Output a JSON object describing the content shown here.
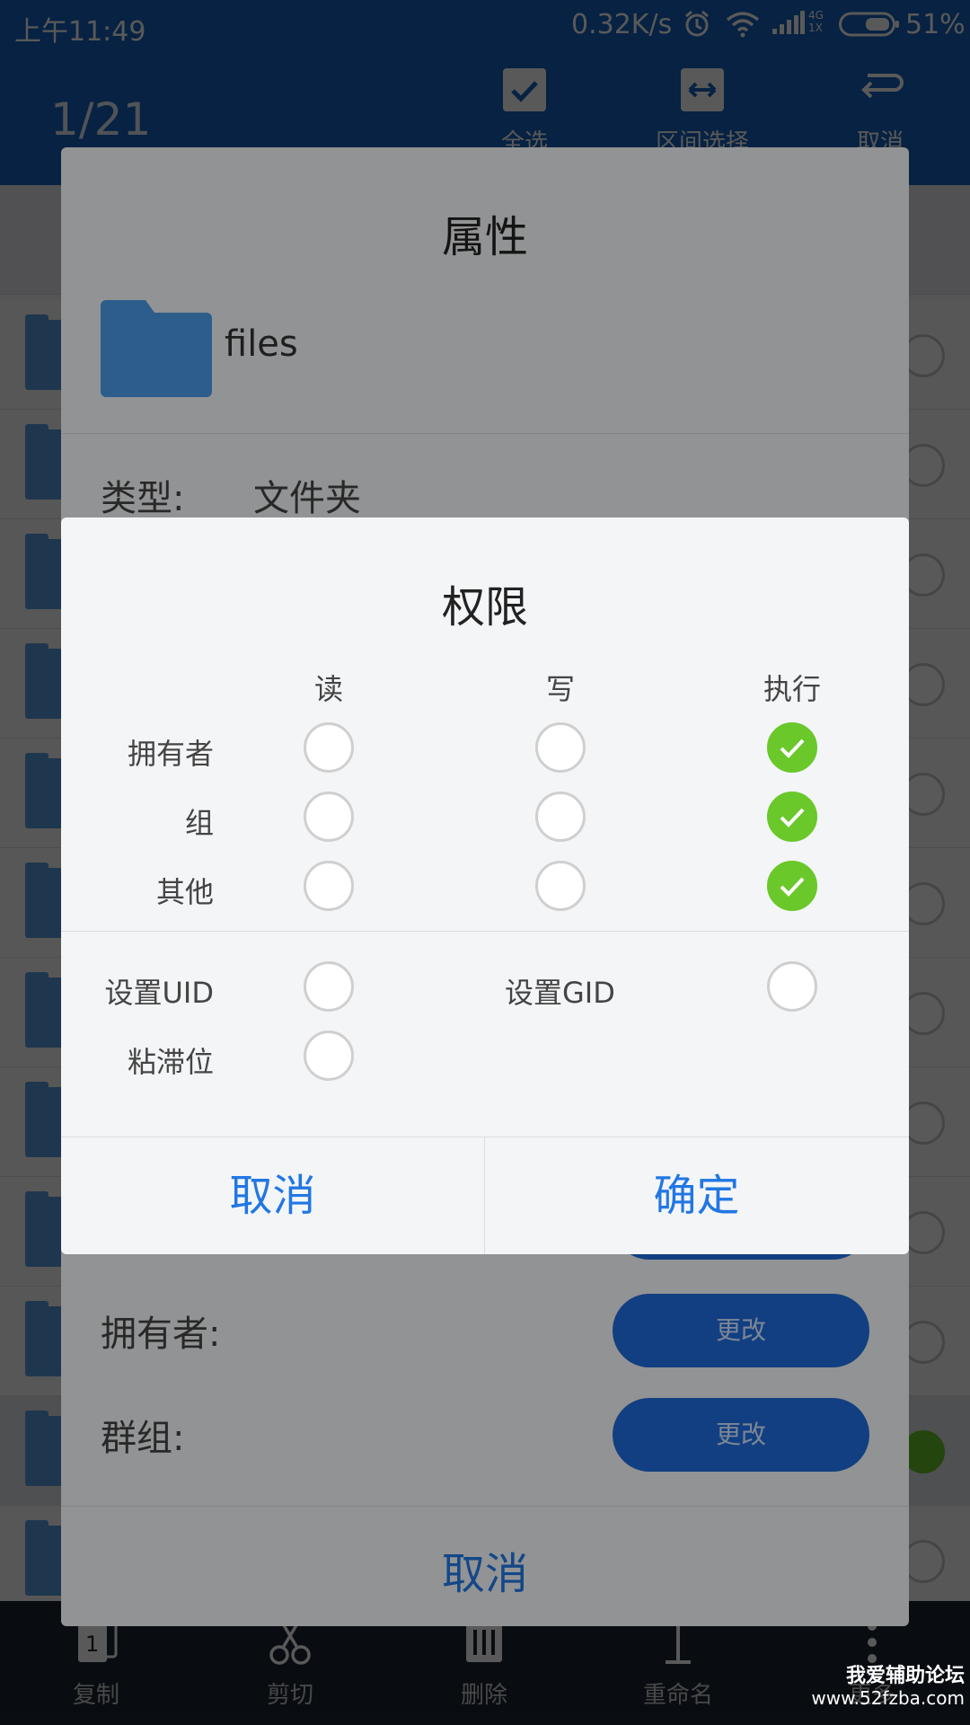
{
  "status_bar": {
    "time": "上午11:49",
    "net_speed": "0.32K/s",
    "network_type": "4G\n1X",
    "battery": "51%",
    "icons": [
      "alarm-icon",
      "wifi-icon",
      "signal-icon",
      "battery-icon"
    ]
  },
  "toolbar": {
    "counter": "1/21",
    "actions": [
      {
        "label": "全选",
        "icon": "select-all-icon"
      },
      {
        "label": "区间选择",
        "icon": "range-select-icon"
      },
      {
        "label": "取消",
        "icon": "undo-icon"
      }
    ]
  },
  "file_list": {
    "row_count": 12,
    "selected_index": 10
  },
  "bottom_bar": {
    "items": [
      {
        "label": "复制",
        "icon": "copy-icon"
      },
      {
        "label": "剪切",
        "icon": "scissors-icon"
      },
      {
        "label": "删除",
        "icon": "delete-icon"
      },
      {
        "label": "重命名",
        "icon": "rename-icon"
      },
      {
        "label": "更多",
        "icon": "more-icon"
      }
    ]
  },
  "properties_dialog": {
    "title": "属性",
    "file_name": "files",
    "type_label": "类型:",
    "type_value": "文件夹",
    "owner_label": "拥有者:",
    "group_label": "群组:",
    "change_label": "更改",
    "cancel_label": "取消"
  },
  "permissions_dialog": {
    "title": "权限",
    "columns": [
      "读",
      "写",
      "执行"
    ],
    "rows": [
      {
        "label": "拥有者",
        "values": [
          false,
          false,
          true
        ]
      },
      {
        "label": "组",
        "values": [
          false,
          false,
          true
        ]
      },
      {
        "label": "其他",
        "values": [
          false,
          false,
          true
        ]
      }
    ],
    "set_uid_label": "设置UID",
    "set_uid_checked": false,
    "set_gid_label": "设置GID",
    "set_gid_checked": false,
    "sticky_label": "粘滞位",
    "sticky_checked": false,
    "cancel_label": "取消",
    "ok_label": "确定",
    "colors": {
      "accent": "#2177e3",
      "checked": "#6ac82a"
    }
  },
  "watermark": {
    "line1": "我爱辅助论坛",
    "line2": "www.52fzba.com"
  }
}
